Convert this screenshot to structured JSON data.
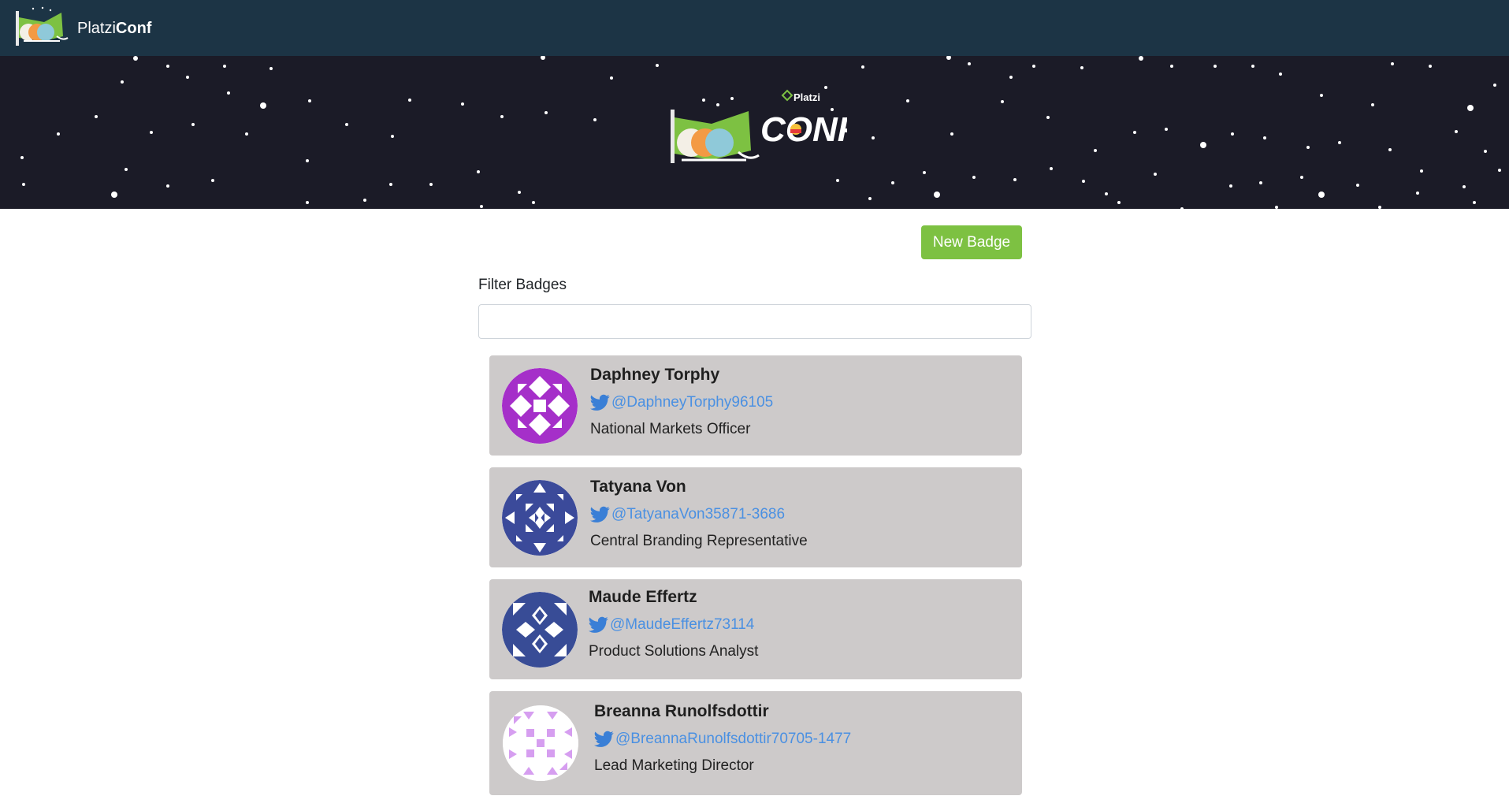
{
  "nav": {
    "brand_light": "Platzi",
    "brand_bold": "Conf"
  },
  "hero": {
    "logo_small": "Platzi",
    "logo_big": "CONF"
  },
  "actions": {
    "new_badge_label": "New Badge"
  },
  "filter": {
    "label": "Filter Badges",
    "value": "",
    "placeholder": ""
  },
  "badges": [
    {
      "name": "Daphney Torphy",
      "twitter": "@DaphneyTorphy96105",
      "job": "National Markets Officer",
      "avatar_color": "#a52fc9"
    },
    {
      "name": "Tatyana Von",
      "twitter": "@TatyanaVon35871-3686",
      "job": "Central Branding Representative",
      "avatar_color": "#3b4a9a"
    },
    {
      "name": "Maude Effertz",
      "twitter": "@MaudeEffertz73114",
      "job": "Product Solutions Analyst",
      "avatar_color": "#384c96"
    },
    {
      "name": "Breanna Runolfsdottir",
      "twitter": "@BreannaRunolfsdottir70705-1477",
      "job": "Lead Marketing Director",
      "avatar_color": "#d69ef0"
    }
  ],
  "colors": {
    "navbar": "#1c3445",
    "hero": "#1b1b27",
    "accent": "#7dc142",
    "card": "#cdcaca",
    "link": "#4a90e2"
  },
  "icons": {
    "twitter": "twitter-bird-icon",
    "logo": "platziconf-logo-icon"
  }
}
